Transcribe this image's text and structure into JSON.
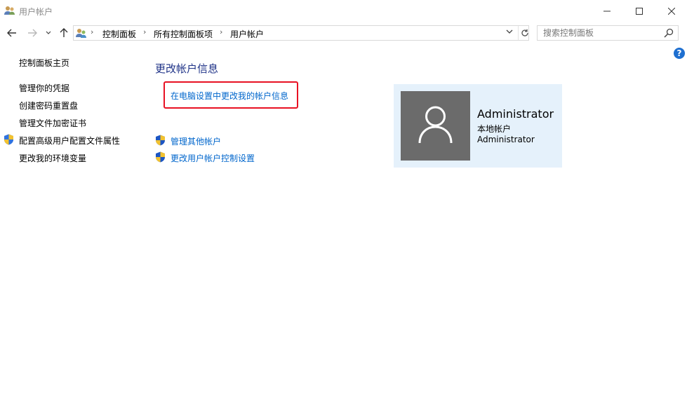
{
  "window": {
    "title": "用户帐户"
  },
  "breadcrumb": [
    "控制面板",
    "所有控制面板项",
    "用户帐户"
  ],
  "search": {
    "placeholder": "搜索控制面板"
  },
  "help": {
    "label": "?"
  },
  "sidebar": {
    "items": [
      {
        "label": "控制面板主页"
      },
      {
        "label": "管理你的凭据"
      },
      {
        "label": "创建密码重置盘"
      },
      {
        "label": "管理文件加密证书"
      },
      {
        "label": "配置高级用户配置文件属性"
      },
      {
        "label": "更改我的环境变量"
      }
    ]
  },
  "main": {
    "heading": "更改帐户信息",
    "highlight_link": "在电脑设置中更改我的帐户信息",
    "links": [
      {
        "label": "管理其他帐户"
      },
      {
        "label": "更改用户帐户控制设置"
      }
    ]
  },
  "account": {
    "name": "Administrator",
    "type": "本地帐户",
    "user": "Administrator"
  },
  "colors": {
    "link": "#0066cc",
    "heading": "#1e3287",
    "highlight_border": "#e81123",
    "card_bg": "#e5f1fb",
    "avatar_bg": "#6b6b6b"
  }
}
